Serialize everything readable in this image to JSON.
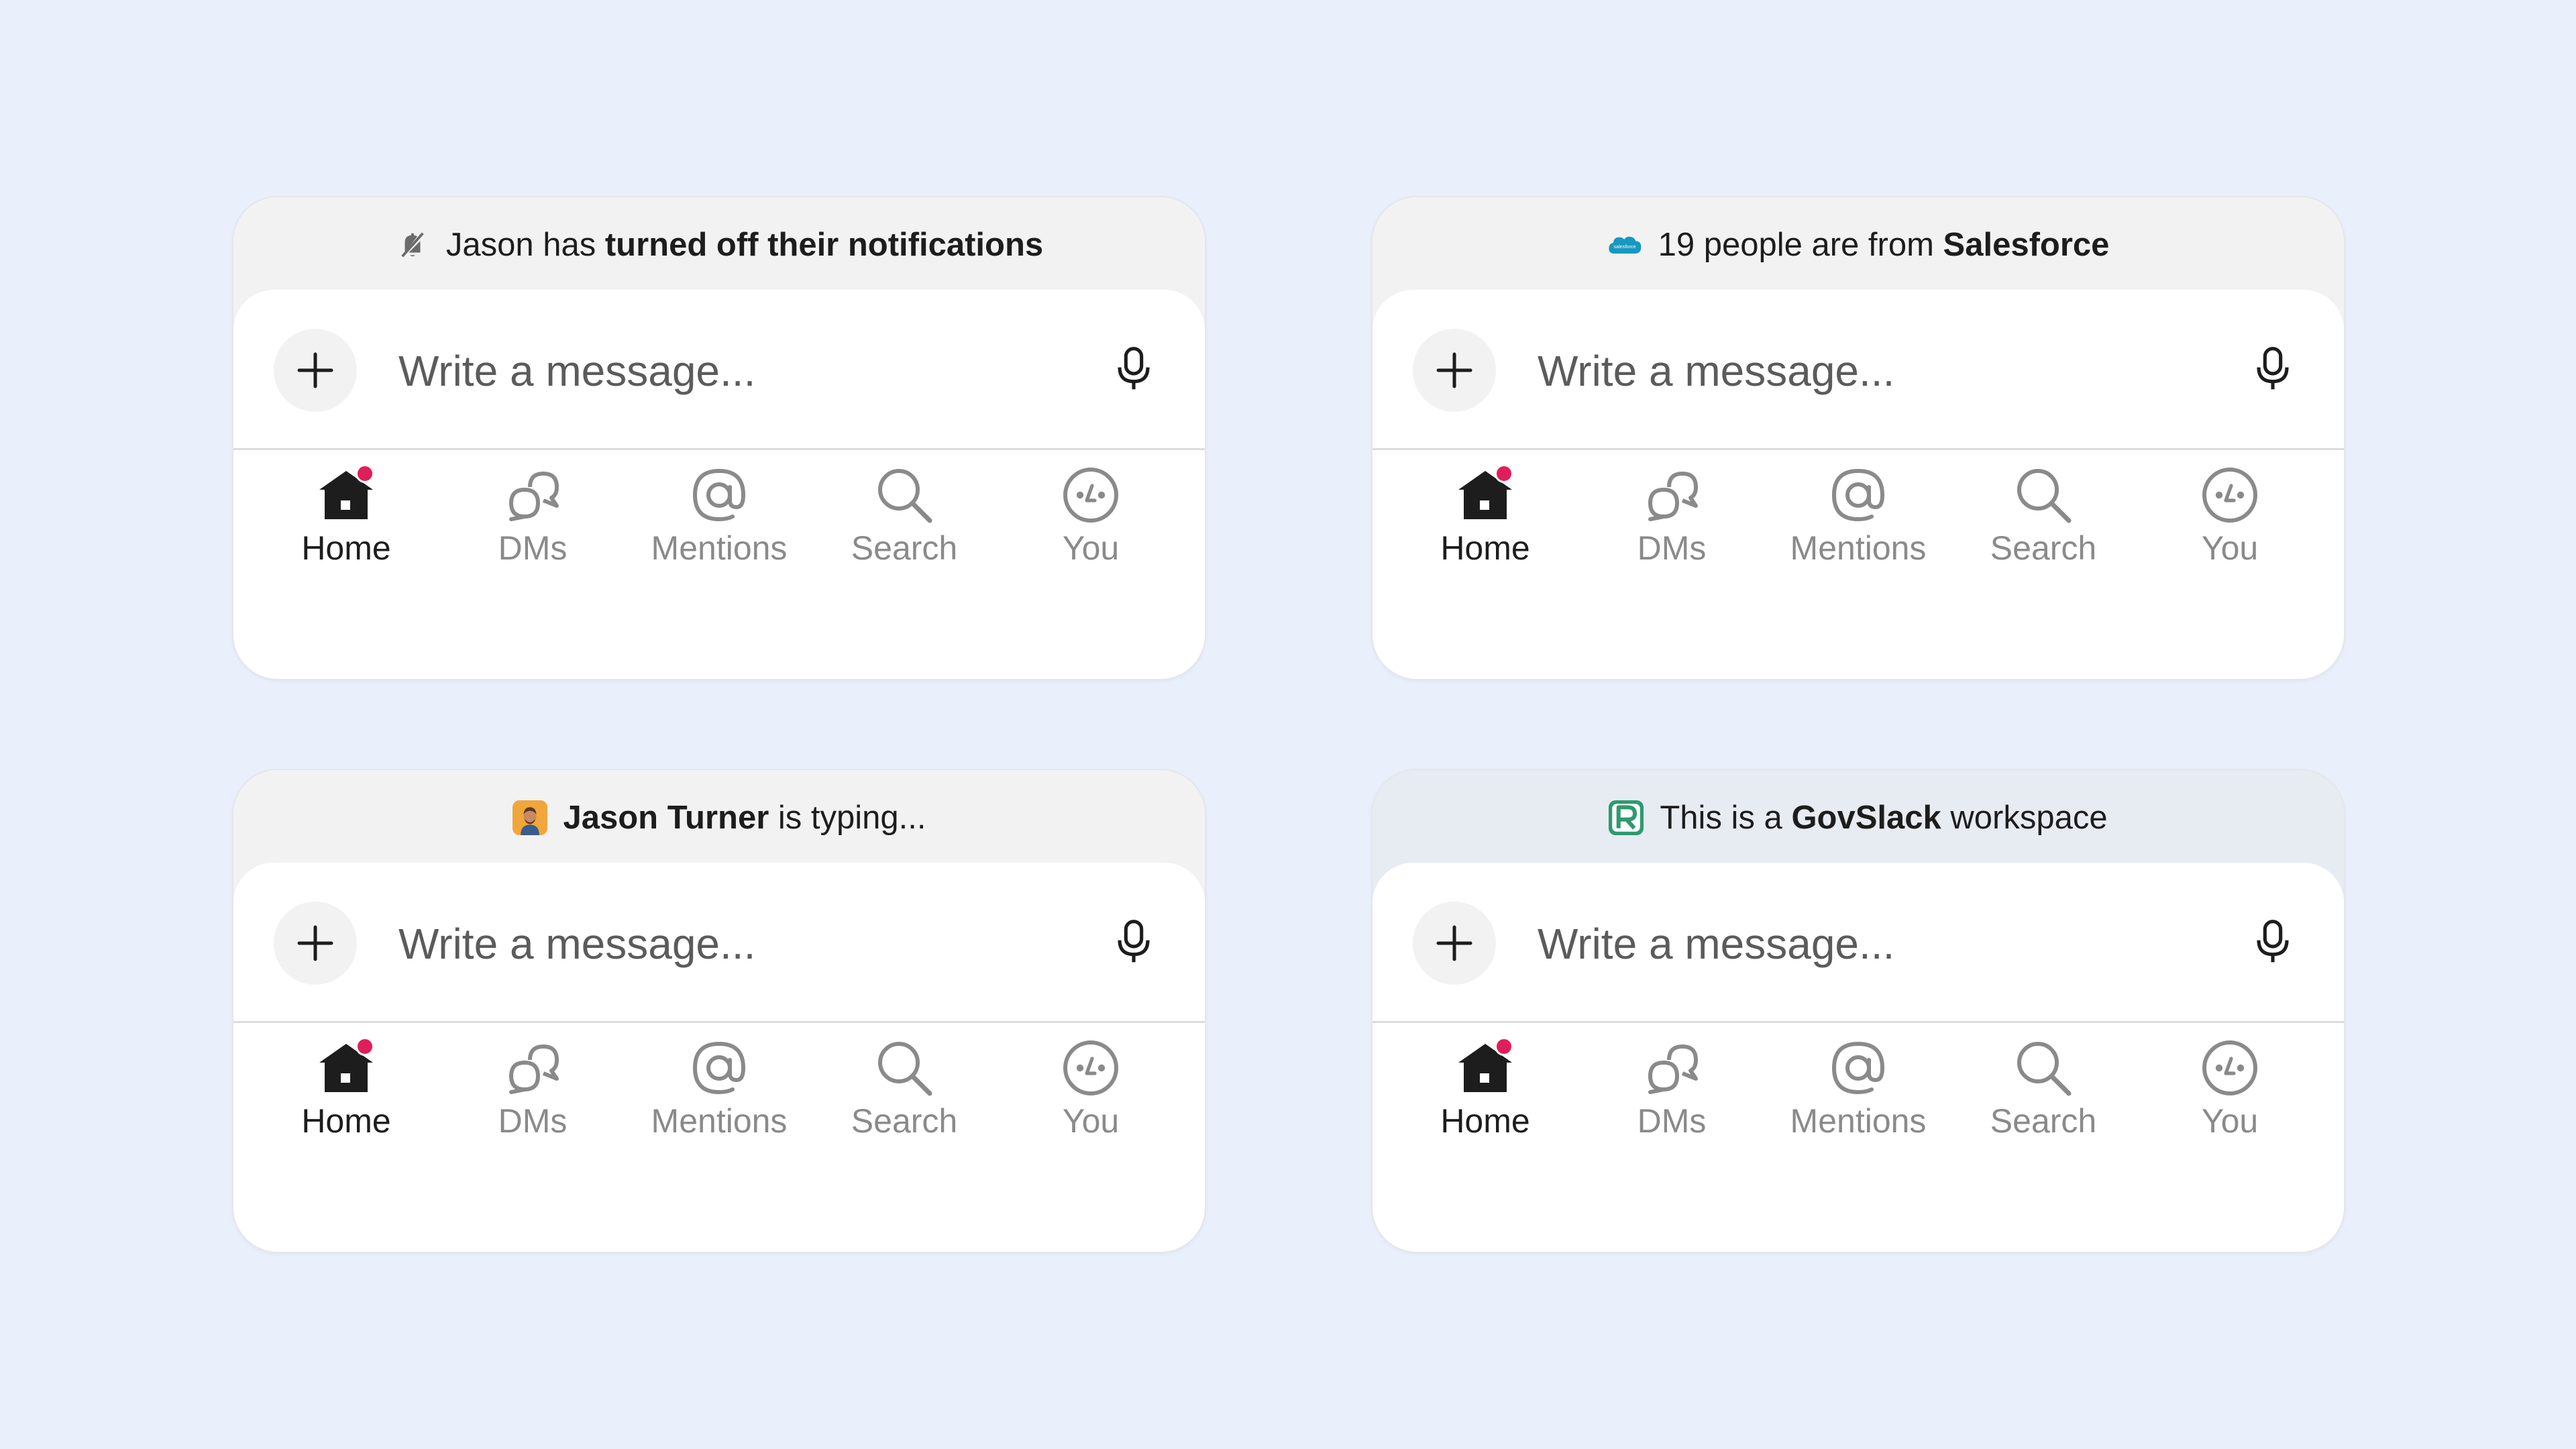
{
  "composer": {
    "placeholder": "Write a message..."
  },
  "tabs": [
    "Home",
    "DMs",
    "Mentions",
    "Search",
    "You"
  ],
  "colors": {
    "background": "#e9effb",
    "badge": "#e01e5a",
    "salesforce": "#1798c1",
    "govslack": "#2e9a6e"
  },
  "cards": [
    {
      "banner": {
        "pre": "Jason has ",
        "bold": "turned off their notifications",
        "post": "",
        "icon": "notifications-off-icon"
      }
    },
    {
      "banner": {
        "pre": "19 people are from ",
        "bold": "Salesforce",
        "post": "",
        "icon": "salesforce-logo-icon",
        "logo_text": "salesforce"
      }
    },
    {
      "banner": {
        "pre": "",
        "bold": "Jason Turner",
        "post": " is typing...",
        "icon": "user-avatar-icon"
      }
    },
    {
      "banner": {
        "pre": "This is a ",
        "bold": "GovSlack",
        "post": " workspace",
        "icon": "govslack-logo-icon"
      }
    }
  ]
}
